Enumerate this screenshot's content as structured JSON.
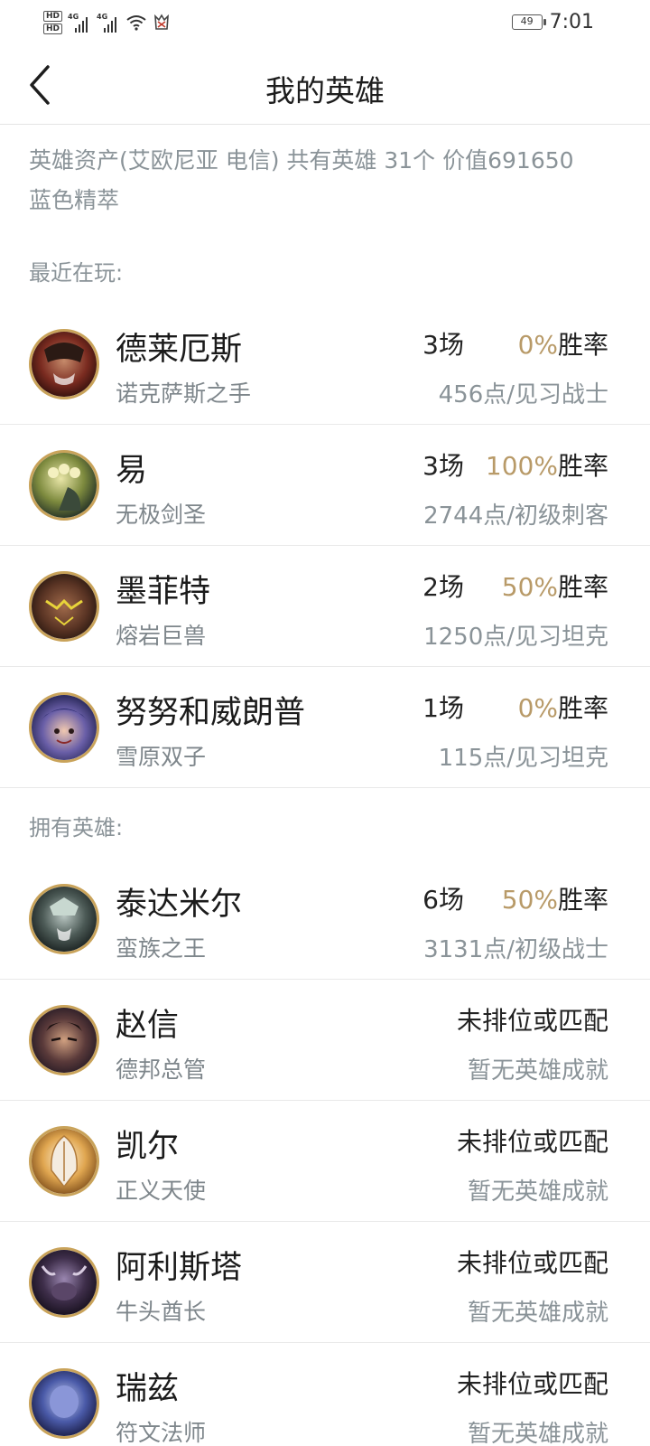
{
  "status_bar": {
    "hd1": "HD",
    "hd2": "HD",
    "net1": "4G",
    "net2": "4G",
    "battery": "49",
    "time": "7:01",
    "icons": [
      "signal-icon",
      "signal-icon",
      "wifi-icon",
      "app-notification-icon",
      "battery-icon"
    ]
  },
  "header": {
    "back_icon": "chevron-left-icon",
    "title": "我的英雄"
  },
  "summary": {
    "text": "英雄资产(艾欧尼亚 电信)  共有英雄 31个  价值691650蓝色精萃"
  },
  "recent": {
    "label": "最近在玩:",
    "heroes": [
      {
        "name": "德莱厄斯",
        "title": "诺克萨斯之手",
        "games": "3场",
        "win_pct": "0%",
        "win_label": "胜率",
        "achievement": "456点/见习战士"
      },
      {
        "name": "易",
        "title": "无极剑圣",
        "games": "3场",
        "win_pct": "100%",
        "win_label": "胜率",
        "achievement": "2744点/初级刺客"
      },
      {
        "name": "墨菲特",
        "title": "熔岩巨兽",
        "games": "2场",
        "win_pct": "50%",
        "win_label": "胜率",
        "achievement": "1250点/见习坦克"
      },
      {
        "name": "努努和威朗普",
        "title": "雪原双子",
        "games": "1场",
        "win_pct": "0%",
        "win_label": "胜率",
        "achievement": "115点/见习坦克"
      }
    ]
  },
  "owned": {
    "label": "拥有英雄:",
    "heroes": [
      {
        "name": "泰达米尔",
        "title": "蛮族之王",
        "games": "6场",
        "win_pct": "50%",
        "win_label": "胜率",
        "achievement": "3131点/初级战士"
      },
      {
        "name": "赵信",
        "title": "德邦总管",
        "status": "未排位或匹配",
        "achievement": "暂无英雄成就"
      },
      {
        "name": "凯尔",
        "title": "正义天使",
        "status": "未排位或匹配",
        "achievement": "暂无英雄成就"
      },
      {
        "name": "阿利斯塔",
        "title": "牛头酋长",
        "status": "未排位或匹配",
        "achievement": "暂无英雄成就"
      },
      {
        "name": "瑞兹",
        "title": "符文法师",
        "status": "未排位或匹配",
        "achievement": "暂无英雄成就"
      }
    ]
  },
  "colors": {
    "win_pct": "#b89a68",
    "secondary_text": "#8a9398",
    "avatar_ring": "#c9a35a",
    "divider": "#e9e9e9"
  }
}
